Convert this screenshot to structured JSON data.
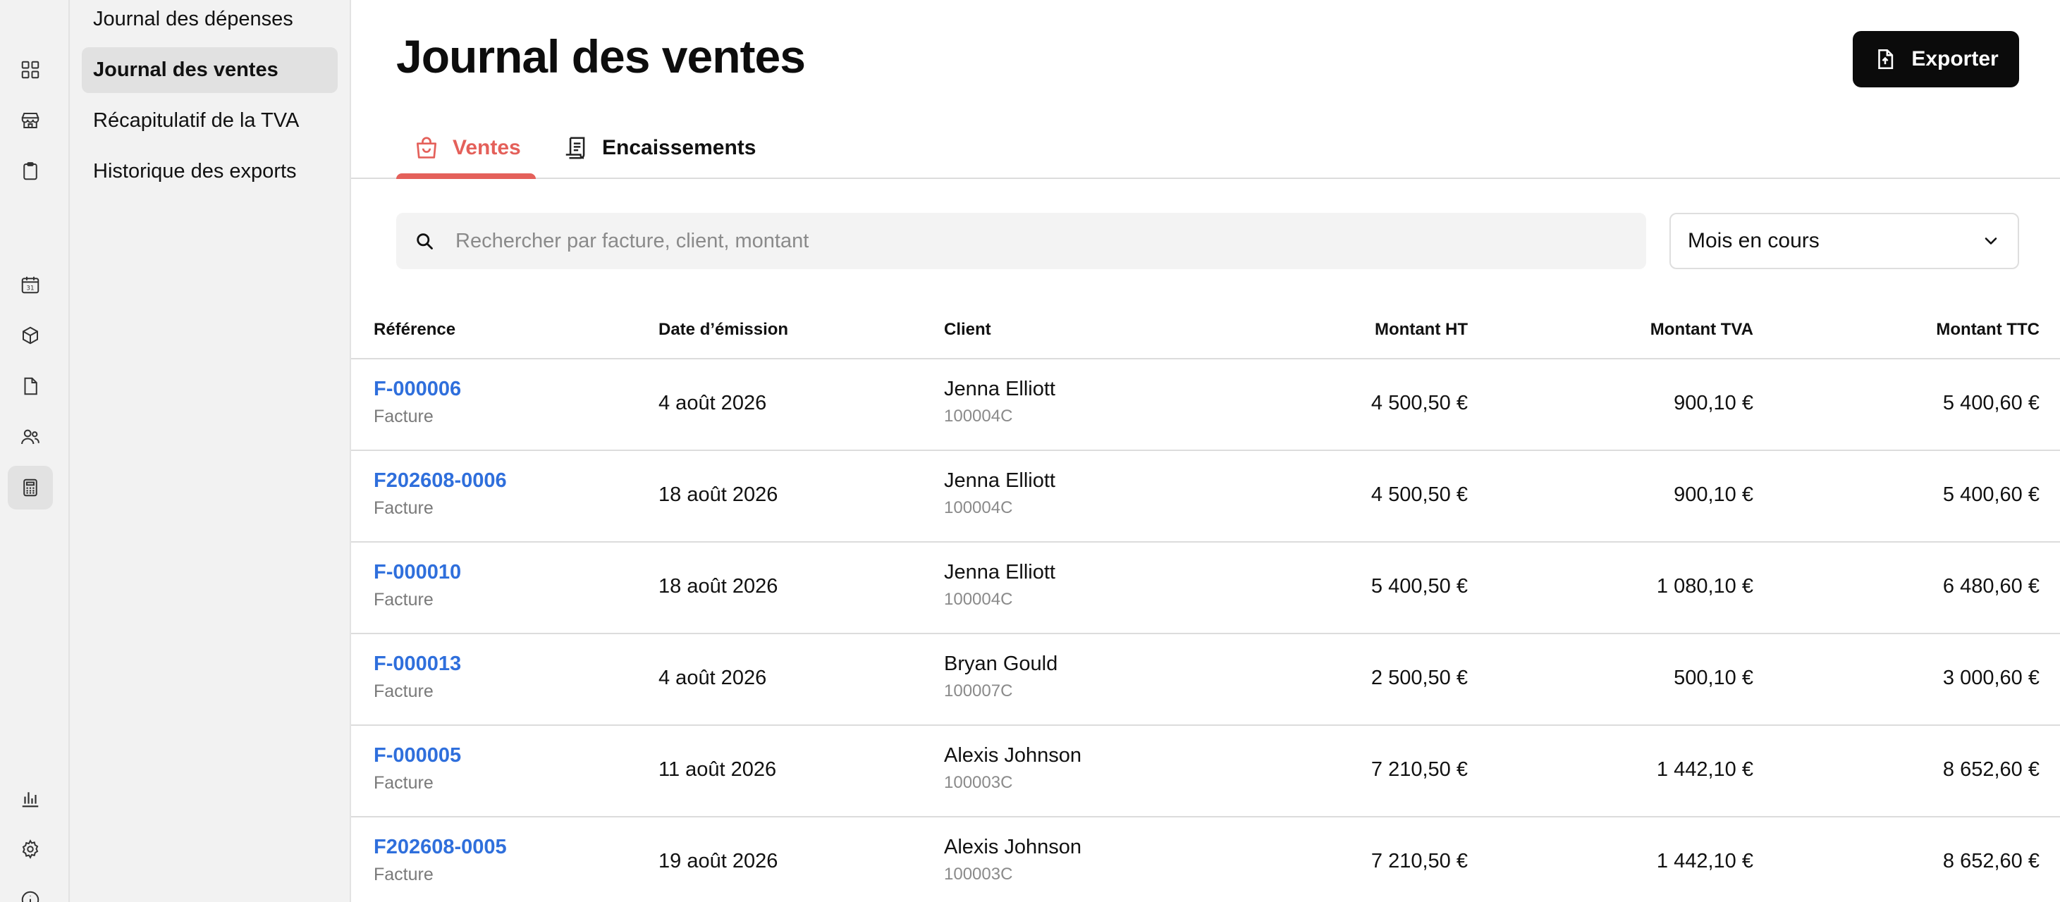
{
  "subnav": {
    "items": [
      {
        "label": "Journal des dépenses",
        "active": false
      },
      {
        "label": "Journal des ventes",
        "active": true
      },
      {
        "label": "Récapitulatif de la TVA",
        "active": false
      },
      {
        "label": "Historique des exports",
        "active": false
      }
    ]
  },
  "rail": {
    "icons": [
      "dashboard-icon",
      "store-icon",
      "clipboard-icon",
      "calendar-icon",
      "box-icon",
      "document-icon",
      "users-icon",
      "calculator-icon",
      "bar-chart-icon",
      "gear-icon",
      "info-icon"
    ],
    "active": "calculator-icon"
  },
  "header": {
    "title": "Journal des ventes",
    "export_label": "Exporter"
  },
  "tabs": [
    {
      "label": "Ventes",
      "icon": "shopping-bag-icon",
      "active": true
    },
    {
      "label": "Encaissements",
      "icon": "receipt-icon",
      "active": false
    }
  ],
  "filters": {
    "search_placeholder": "Rechercher par facture, client, montant",
    "search_value": "",
    "period": "Mois en cours"
  },
  "table": {
    "columns": [
      "Référence",
      "Date d’émission",
      "Client",
      "Montant HT",
      "Montant TVA",
      "Montant TTC"
    ],
    "rows": [
      {
        "ref": "F-000006",
        "type": "Facture",
        "date": "4 août 2026",
        "client": "Jenna Elliott",
        "code": "100004C",
        "ht": "4 500,50 €",
        "tva": "900,10 €",
        "ttc": "5 400,60 €"
      },
      {
        "ref": "F202608-0006",
        "type": "Facture",
        "date": "18 août 2026",
        "client": "Jenna Elliott",
        "code": "100004C",
        "ht": "4 500,50 €",
        "tva": "900,10 €",
        "ttc": "5 400,60 €"
      },
      {
        "ref": "F-000010",
        "type": "Facture",
        "date": "18 août 2026",
        "client": "Jenna Elliott",
        "code": "100004C",
        "ht": "5 400,50 €",
        "tva": "1 080,10 €",
        "ttc": "6 480,60 €"
      },
      {
        "ref": "F-000013",
        "type": "Facture",
        "date": "4 août 2026",
        "client": "Bryan Gould",
        "code": "100007C",
        "ht": "2 500,50 €",
        "tva": "500,10 €",
        "ttc": "3 000,60 €"
      },
      {
        "ref": "F-000005",
        "type": "Facture",
        "date": "11 août 2026",
        "client": "Alexis Johnson",
        "code": "100003C",
        "ht": "7 210,50 €",
        "tva": "1 442,10 €",
        "ttc": "8 652,60 €"
      },
      {
        "ref": "F202608-0005",
        "type": "Facture",
        "date": "19 août 2026",
        "client": "Alexis Johnson",
        "code": "100003C",
        "ht": "7 210,50 €",
        "tva": "1 442,10 €",
        "ttc": "8 652,60 €"
      }
    ]
  },
  "colors": {
    "accent": "#e4605a",
    "link": "#2f6fdc",
    "sidebar_bg": "#f2f2f2",
    "button_bg": "#0b0b0b"
  }
}
